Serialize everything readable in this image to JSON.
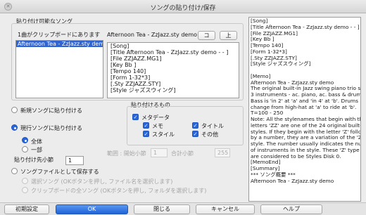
{
  "window": {
    "title": "ソングの貼り付け/保存"
  },
  "left_panel": {
    "group_title": "貼り付け可能なソング",
    "clipboard_count_label": "1曲がクリップボードにあります",
    "song_list": [
      {
        "label": "Afternoon Tea - ZzJazz.sty demo - -",
        "selected": true
      }
    ],
    "preview_header": "Afternoon Tea - ZzJazz.sty demo - -",
    "up_buttons": [
      "コ",
      "上"
    ],
    "preview_lines": [
      "[Song]",
      "[Title Afternoon Tea - ZzJazz.sty demo - - ]",
      "[File ZZJAZZ.MG1]",
      "[Key Bb ]",
      "[Tempo 140]",
      "[Form 1-32*3]",
      "[.Sty ZZJAZZ.STY]",
      "[Style ジャズスウィング]"
    ]
  },
  "paste_options": {
    "new_song_label": "新規ソングに貼り付ける",
    "current_song_label": "現行ソングに貼り付ける",
    "all_label": "全体",
    "part_label": "一部",
    "paste_start_bar_label": "貼り付け先小節",
    "paste_start_bar_value": "1",
    "save_file_label": "ソングファイルとして保存する",
    "selected_songs_label": "選択ソング (OKボタンを押し, ファイル名を選択します)",
    "all_clipboard_label": "クリップボードの全ソング (OKボタンを押し, フォルダを選択します)",
    "selected": "current_song"
  },
  "paste_things": {
    "group_title": "貼り付けるもの",
    "metadata_label": "メタデータ",
    "memo_label": "メモ",
    "title_label": "タイトル",
    "style_label": "スタイル",
    "other_label": "その他",
    "range_label": "範囲 : 開始小節",
    "range_start": "1",
    "total_bars_label": "合計小節",
    "total_bars_value": "255"
  },
  "right_text": {
    "lines": [
      "[Song]",
      "[Title Afternoon Tea - ZzJazz.sty demo - - ]",
      "[File ZZJAZZ.MG1]",
      "[Key Bb ]",
      "[Tempo 140]",
      "[Form 1-32*3]",
      "[.Sty ZZJAZZ.STY]",
      "[Style ジャズスウィング]",
      "",
      "[Memo]",
      "Afternoon Tea - ZzJazz.sty demo",
      "The original built-in Jazz swing piano trio style.",
      "3 instruments - ac. piano, ac. bass & drums.",
      "Bass is 'in 2' at 'a' and  'in 4' at 'b'. Drums",
      "change from high-hat at 'a' to ride at 'b'.",
      "T=100 - 250",
      "Note: All the stylenames that begin with the",
      "letters 'ZZ' are one of the 24 original built-in BB",
      "styles. If they begin with the letter 'Z' followed",
      "by a number, they are a variation of the 'ZZ'",
      "style. The number usually indicates the number",
      "of instruments in the style. These 'Z' type styles",
      "are considered to be Styles Disk 0.",
      "[MemoEnd]",
      "[Summary]",
      "***   ソング概要   ***",
      "Afternoon Tea - ZzJazz.sty demo"
    ]
  },
  "footer": {
    "defaults": "初期設定",
    "ok": "OK",
    "close": "閉じる",
    "cancel": "キャンセル",
    "help": "ヘルプ"
  }
}
